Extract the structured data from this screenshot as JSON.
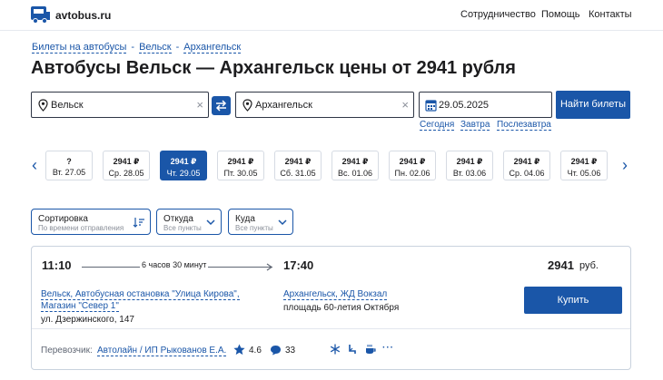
{
  "header": {
    "logo_text": "avtobus.ru",
    "nav": [
      "Сотрудничество",
      "Помощь",
      "Контакты"
    ]
  },
  "breadcrumb": [
    "Билеты на автобусы",
    "Вельск",
    "Архангельск"
  ],
  "title": "Автобусы Вельск — Архангельск цены от 2941 рубля",
  "search": {
    "from": "Вельск",
    "to": "Архангельск",
    "date": "29.05.2025",
    "button": "Найти билеты",
    "quick_dates": [
      "Сегодня",
      "Завтра",
      "Послезавтра"
    ]
  },
  "dates": [
    {
      "price": "?",
      "day": "Вт. 27.05"
    },
    {
      "price": "2941 ₽",
      "day": "Ср. 28.05"
    },
    {
      "price": "2941 ₽",
      "day": "Чт. 29.05"
    },
    {
      "price": "2941 ₽",
      "day": "Пт. 30.05"
    },
    {
      "price": "2941 ₽",
      "day": "Сб. 31.05"
    },
    {
      "price": "2941 ₽",
      "day": "Вс. 01.06"
    },
    {
      "price": "2941 ₽",
      "day": "Пн. 02.06"
    },
    {
      "price": "2941 ₽",
      "day": "Вт. 03.06"
    },
    {
      "price": "2941 ₽",
      "day": "Ср. 04.06"
    },
    {
      "price": "2941 ₽",
      "day": "Чт. 05.06"
    }
  ],
  "selected_date": "Чт. 29.05",
  "filters": {
    "sort": {
      "title": "Сортировка",
      "sub": "По времени отправления"
    },
    "from": {
      "title": "Откуда",
      "sub": "Все пункты"
    },
    "to": {
      "title": "Куда",
      "sub": "Все пункты"
    }
  },
  "trip": {
    "depart_time": "11:10",
    "duration": "6 часов 30 минут",
    "arrive_time": "17:40",
    "price": "2941",
    "currency": "руб.",
    "buy_label": "Купить",
    "from_stop_line1": "Вельск, Автобусная остановка \"Улица Кирова\",",
    "from_stop_line2": "Магазин \"Север 1\"",
    "from_addr": "ул. Дзержинского, 147",
    "to_stop": "Архангельск, ЖД Вокзал",
    "to_addr": "площадь 60-летия Октября",
    "carrier_label": "Перевозчик:",
    "carrier_name": "Автолайн / ИП Рыкованов Е.А.",
    "rating": "4.6",
    "reviews": "33"
  },
  "colors": {
    "accent": "#1a56a8",
    "border": "#c9d2de"
  }
}
